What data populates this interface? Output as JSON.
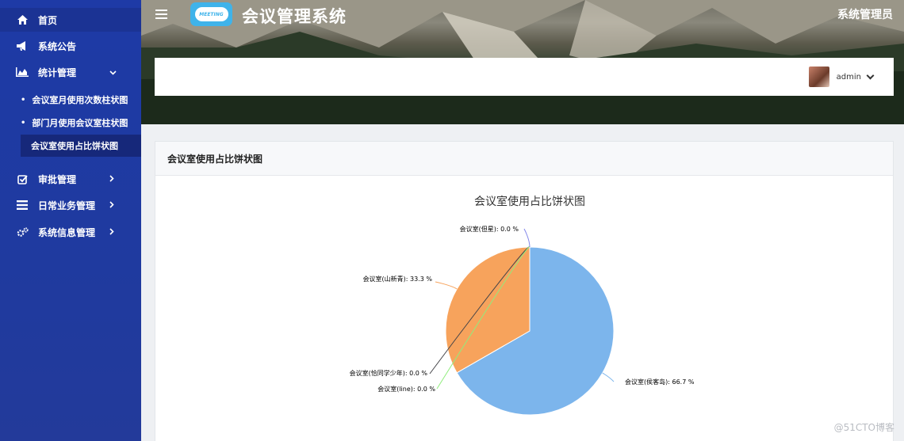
{
  "sidebar": {
    "items": [
      {
        "label": "首页",
        "icon": "home-icon"
      },
      {
        "label": "系统公告",
        "icon": "megaphone-icon"
      },
      {
        "label": "统计管理",
        "icon": "area-chart-icon"
      },
      {
        "label": "审批管理",
        "icon": "check-square-icon"
      },
      {
        "label": "日常业务管理",
        "icon": "list-icon"
      },
      {
        "label": "系统信息管理",
        "icon": "gears-icon"
      }
    ],
    "sub_items": [
      {
        "label": "会议室月使用次数柱状图"
      },
      {
        "label": "部门月使用会议室柱状图"
      },
      {
        "label": "会议室使用占比饼状图"
      }
    ]
  },
  "header": {
    "logo_text": "MEETING",
    "title": "会议管理系统",
    "role": "系统管理员",
    "user": "admin"
  },
  "panel": {
    "title": "会议室使用占比饼状图"
  },
  "watermark": "@51CTO博客",
  "colors": {
    "sidebar": "#1f3aa3",
    "slice_blue": "#7cb5ec",
    "slice_orange": "#f7a35c",
    "slice_dark": "#434348",
    "slice_green": "#90ed7d",
    "slice_purple": "#8085e9"
  },
  "chart_data": {
    "type": "pie",
    "title": "会议室使用占比饼状图",
    "slices": [
      {
        "name": "会议室(侯客岛)",
        "value": 66.7,
        "label": "会议室(侯客岛): 66.7 %",
        "color": "#7cb5ec"
      },
      {
        "name": "会议室(山新青)",
        "value": 33.3,
        "label": "会议室(山新青): 33.3 %",
        "color": "#f7a35c"
      },
      {
        "name": "会议室(恰同学少年)",
        "value": 0.0,
        "label": "会议室(恰同学少年): 0.0 %",
        "color": "#434348"
      },
      {
        "name": "会议室(line)",
        "value": 0.0,
        "label": "会议室(line): 0.0 %",
        "color": "#90ed7d"
      },
      {
        "name": "会议室(但星)",
        "value": 0.0,
        "label": "会议室(但星): 0.0 %",
        "color": "#8085e9"
      }
    ]
  }
}
